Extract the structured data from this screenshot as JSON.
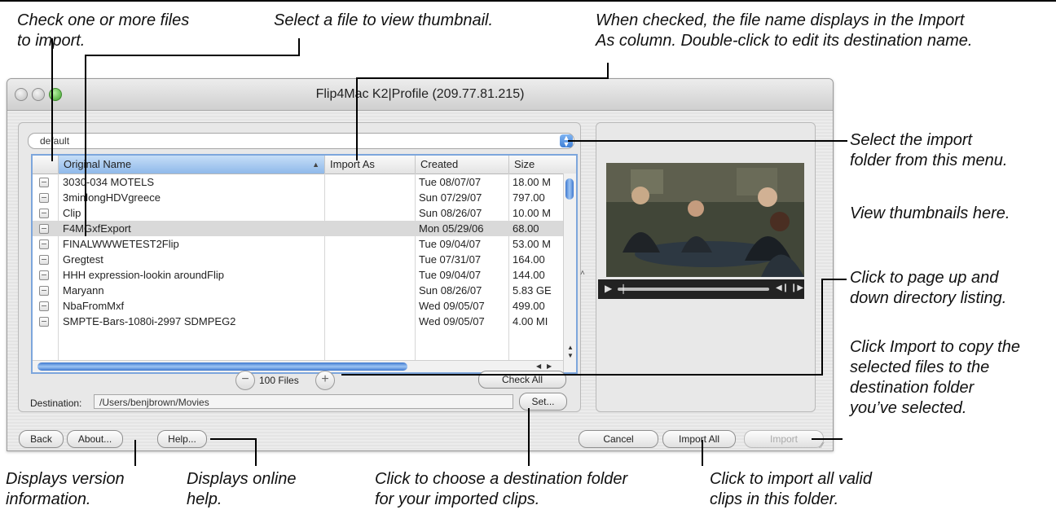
{
  "annotations": {
    "check_files": "Check one or more files\nto import.",
    "select_thumbnail": "Select a file to view thumbnail.",
    "import_as": "When checked, the file name displays in the Import\nAs column. Double-click to edit its destination name.",
    "import_folder": "Select the import\nfolder from this menu.",
    "view_thumbnails": "View thumbnails here.",
    "page_up_down": "Click to page up and\ndown directory listing.",
    "import_copy": "Click Import to copy the\nselected files to the\ndestination folder\nyou’ve selected.",
    "version_info": "Displays version\ninformation.",
    "online_help": "Displays online\nhelp.",
    "destination_folder": "Click to choose a destination folder\nfor your imported clips.",
    "import_all_valid": "Click to import all valid\nclips in this folder."
  },
  "window": {
    "title": "Flip4Mac K2|Profile (209.77.81.215)"
  },
  "folder_popup": {
    "value": "default"
  },
  "table": {
    "columns": [
      "Original Name",
      "Import As",
      "Created",
      "Size"
    ],
    "rows": [
      {
        "name": "3030-034 MOTELS",
        "import_as": "",
        "created": "Tue 08/07/07",
        "size": "18.00 M"
      },
      {
        "name": "3minlongHDVgreece",
        "import_as": "",
        "created": "Sun 07/29/07",
        "size": "797.00"
      },
      {
        "name": "Clip",
        "import_as": "",
        "created": "Sun 08/26/07",
        "size": "10.00 M"
      },
      {
        "name": "F4MGxfExport",
        "import_as": "",
        "created": "Mon 05/29/06",
        "size": "68.00"
      },
      {
        "name": "FINALWWWETEST2Flip",
        "import_as": "",
        "created": "Tue 09/04/07",
        "size": "53.00 M"
      },
      {
        "name": "Gregtest",
        "import_as": "",
        "created": "Tue 07/31/07",
        "size": "164.00"
      },
      {
        "name": "HHH expression-lookin aroundFlip",
        "import_as": "",
        "created": "Tue 09/04/07",
        "size": "144.00"
      },
      {
        "name": "Maryann",
        "import_as": "",
        "created": "Sun 08/26/07",
        "size": "5.83 GE"
      },
      {
        "name": "NbaFromMxf",
        "import_as": "",
        "created": "Wed 09/05/07",
        "size": "499.00"
      },
      {
        "name": "SMPTE-Bars-1080i-2997 SDMPEG2",
        "import_as": "",
        "created": "Wed 09/05/07",
        "size": "4.00 MI"
      }
    ]
  },
  "file_count": "100 Files",
  "buttons": {
    "check_all": "Check All",
    "set": "Set...",
    "back": "Back",
    "about": "About...",
    "help": "Help...",
    "cancel": "Cancel",
    "import_all": "Import All",
    "import": "Import"
  },
  "destination": {
    "label": "Destination:",
    "value": "/Users/benjbrown/Movies"
  },
  "colors": {
    "selection_blue": "#7da6dc",
    "green_button": "#3d9f2a"
  }
}
